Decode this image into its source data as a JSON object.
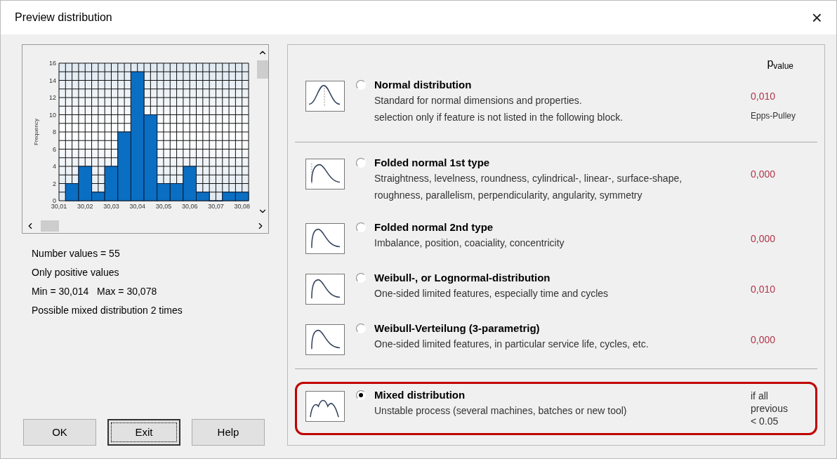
{
  "window": {
    "title": "Preview distribution",
    "close": "×"
  },
  "histogram": {
    "chart_data": {
      "type": "bar",
      "ylabel": "Frequency",
      "x": [
        30.015,
        30.02,
        30.025,
        30.03,
        30.035,
        30.04,
        30.045,
        30.05,
        30.055,
        30.06,
        30.065,
        30.07,
        30.075,
        30.08
      ],
      "values": [
        2,
        4,
        1,
        4,
        8,
        15,
        10,
        2,
        2,
        4,
        1,
        0,
        1,
        1
      ],
      "xlim": [
        30.01,
        30.0825
      ],
      "grid": true,
      "ylim": [
        0,
        16
      ],
      "xticks": [
        {
          "value": 30.01,
          "label": "30,01"
        },
        {
          "value": 30.02,
          "label": "30,02"
        },
        {
          "value": 30.03,
          "label": "30,03"
        },
        {
          "value": 30.04,
          "label": "30,04"
        },
        {
          "value": 30.05,
          "label": "30,05"
        },
        {
          "value": 30.06,
          "label": "30,06"
        },
        {
          "value": 30.07,
          "label": "30,07"
        },
        {
          "value": 30.08,
          "label": "30,08"
        }
      ],
      "yticks": [
        0,
        2,
        4,
        6,
        8,
        10,
        12,
        14,
        16
      ]
    }
  },
  "stats": [
    "Number values = 55",
    "Only positive values",
    "Min = 30,014   Max = 30,078",
    "Possible mixed distribution 2 times"
  ],
  "buttons": [
    {
      "label": "OK",
      "focused": false
    },
    {
      "label": "Exit",
      "focused": true
    },
    {
      "label": "Help",
      "focused": false
    }
  ],
  "pvalue_header": "p$_{value}$",
  "groups": [
    [
      {
        "kind": "normal",
        "title": "Normal distribution",
        "description": [
          "Standard for normal dimensions and properties.",
          "selection only if feature is not listed in the following block."
        ],
        "selected": false,
        "highlighted": false,
        "pvalue": "0,010",
        "test": "Epps-Pulley"
      }
    ],
    [
      {
        "kind": "folded",
        "title": "Folded normal 1st type",
        "description": [
          "Straightness, levelness, roundness, cylindrical-, linear-, surface-shape,",
          "roughness, parallelism, perpendicularity, angularity, symmetry"
        ],
        "selected": false,
        "highlighted": false,
        "pvalue": "0,000"
      },
      {
        "kind": "skewed",
        "title": "Folded normal 2nd type",
        "description": [
          "Imbalance, position, coaciality, concentricity"
        ],
        "selected": false,
        "highlighted": false,
        "pvalue": "0,000"
      },
      {
        "kind": "skewed",
        "title": "Weibull-, or Lognormal-distribution",
        "description": [
          "One-sided limited features, especially time and cycles"
        ],
        "selected": false,
        "highlighted": false,
        "pvalue": "0,010"
      },
      {
        "kind": "skewed",
        "title": "Weibull-Verteilung (3-parametrig)",
        "description": [
          "One-sided limited features, in particular service life, cycles, etc."
        ],
        "selected": false,
        "highlighted": false,
        "pvalue": "0,000"
      }
    ],
    [
      {
        "kind": "mixed",
        "title": "Mixed distribution",
        "description": [
          "Unstable process (several machines, batches or new tool)"
        ],
        "selected": true,
        "highlighted": true,
        "note": [
          "if all",
          "previous",
          "< 0.05"
        ]
      }
    ]
  ]
}
